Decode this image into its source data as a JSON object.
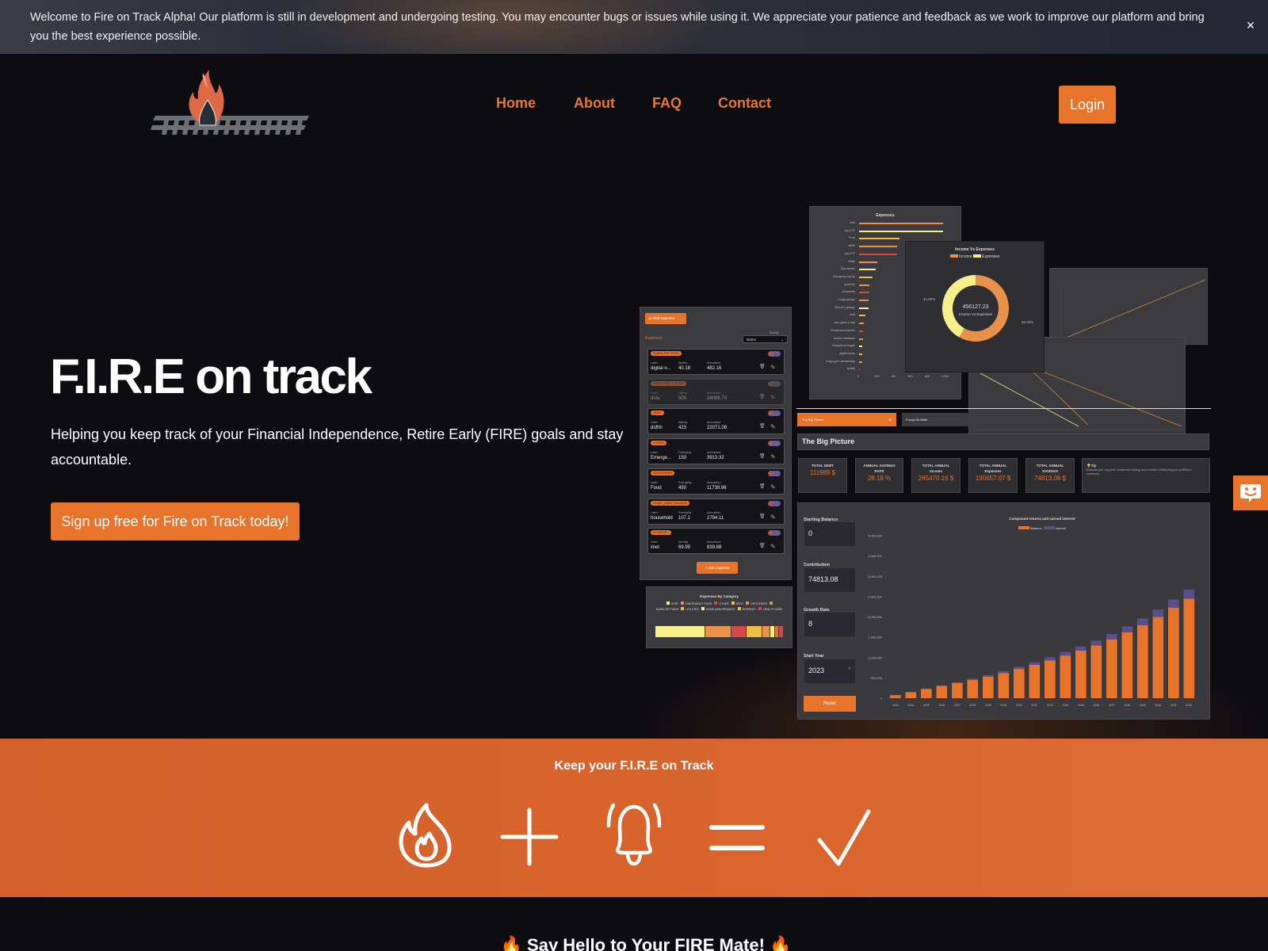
{
  "banner": {
    "text": "Welcome to Fire on Track Alpha! Our platform is still in development and undergoing testing. You may encounter bugs or issues while using it. We appreciate your patience and feedback as we work to improve our platform and bring you the best experience possible.",
    "close": "×"
  },
  "nav": {
    "items": [
      "Home",
      "About",
      "FAQ",
      "Contact"
    ],
    "login": "Login"
  },
  "hero": {
    "title": "F.I.R.E on track",
    "subtitle": "Helping you keep track of your Financial Independence, Retire Early (FIRE) goals and stay accountable.",
    "cta": "Sign up free for Fire on Track today!"
  },
  "colors": {
    "accent": "#e8742c",
    "background": "#0d0c11",
    "band": "#d9652d"
  },
  "mock": {
    "hide_expense": "Hide Expense",
    "expenses_label": "Expenses",
    "sort_label": "Sort By",
    "sort_value": "Name",
    "add_expense": "+ Add Expense",
    "field_label": "Label",
    "annualized_label": "Annualized",
    "rows": [
      {
        "category": "SUBSCRIPTIONS",
        "label": "digital o...",
        "freq": "Weekly",
        "amount": "40.18",
        "annual": "482.16",
        "disabled": false
      },
      {
        "category": "EMERGENCY_FUND",
        "label": "dsfa",
        "freq": "Weekly",
        "amount": "500",
        "annual": "26088.75",
        "disabled": true
      },
      {
        "category": "DEBT",
        "label": "dsfhh",
        "freq": "Weekly",
        "amount": "423",
        "annual": "22071.08",
        "disabled": false
      },
      {
        "category": "OTHER",
        "label": "Emerge...",
        "freq": "Fortnightly",
        "amount": "150",
        "annual": "3913.32",
        "disabled": false
      },
      {
        "category": "GROCERIES",
        "label": "Food",
        "freq": "Fortnightly",
        "amount": "450",
        "annual": "11739.96",
        "disabled": false
      },
      {
        "category": "HOME_MAINTENANCE",
        "label": "household",
        "freq": "Fortnightly",
        "amount": "107.1",
        "annual": "2794.11",
        "disabled": false
      },
      {
        "category": "INTERNET",
        "label": "iinet",
        "freq": "Monthly",
        "amount": "69.99",
        "annual": "839.88",
        "disabled": false
      }
    ],
    "category_chart": {
      "title": "Expenses By Category",
      "legend": [
        "DEBT",
        "EMERGENCY FUND",
        "OTHER",
        "RENT",
        "GROCERIES",
        "SUBSCRIPTIONS",
        "UTILITIES",
        "HOME MAINTENANCE",
        "INTERNET",
        "HEALTH CARE"
      ],
      "segments": [
        {
          "color": "#f6ef8a",
          "share": 40
        },
        {
          "color": "#e8914a",
          "share": 21
        },
        {
          "color": "#d9474a",
          "share": 12
        },
        {
          "color": "#eec04a",
          "share": 12
        },
        {
          "color": "#e8914a",
          "share": 6
        },
        {
          "color": "#f6ef8a",
          "share": 3
        },
        {
          "color": "#e8742c",
          "share": 3
        },
        {
          "color": "#d9474a",
          "share": 3
        }
      ]
    },
    "expenses_chart": {
      "title": "Expenses",
      "labels": [
        "dsfa",
        "ocp-ETF",
        "Food",
        "dsfhh",
        "ocp-ETF",
        "Smile",
        "Gym trainer",
        "Emergency top up",
        "quarterly",
        "household",
        "Tunga splurge",
        "Marion's splurge",
        "iinet",
        "who gives a crap",
        "Vodaphone marions",
        "marion medibank",
        "Vodaphone tungas",
        "digital ocean",
        "tunga gym membership",
        "spotify"
      ],
      "values": [
        1000,
        1000,
        480,
        450,
        450,
        220,
        200,
        160,
        120,
        120,
        110,
        110,
        80,
        60,
        50,
        50,
        40,
        40,
        40,
        10
      ],
      "colors": [
        "#e8914a",
        "#f6ef8a",
        "#eec04a",
        "#e8914a",
        "#d9474a",
        "#e8914a",
        "#f6ef8a",
        "#eec04a",
        "#e8914a",
        "#d9474a",
        "#e8914a",
        "#f6ef8a",
        "#eec04a",
        "#e8914a",
        "#d9474a",
        "#e8914a",
        "#f6ef8a",
        "#eec04a",
        "#e8914a",
        "#d9474a"
      ],
      "ticks": [
        "0",
        "200",
        "400",
        "600",
        "800",
        "1,000"
      ]
    },
    "donut": {
      "title": "Income Vs Expenses",
      "legend": [
        "Income",
        "Expenses"
      ],
      "center_value": "456127.23",
      "center_label": "Income Vs Expenses",
      "pct_income": "58.20%",
      "pct_expenses": "41.80%",
      "income_share": 58.2
    },
    "tabs": [
      "The Big Picture",
      "Focus On Debt"
    ],
    "big_picture_title": "The Big Picture",
    "stats": [
      {
        "label": "TOTAL DEBT",
        "value": "111989 $"
      },
      {
        "label": "ANNUAL SAVINGS RATE",
        "value": "28.18 %"
      },
      {
        "label": "TOTAL ANNUAL Income",
        "value": "265470.16 $"
      },
      {
        "label": "TOTAL ANNUAL Expenses",
        "value": "190657.07 $"
      },
      {
        "label": "TOTAL ANNUAL SAVINGS",
        "value": "74813.08 $"
      }
    ],
    "tip": {
      "title": "💡Tip",
      "text": "Evaluate your long-term investment strategy and consider rebalancing your portfolio if necessary."
    },
    "compound": {
      "starting_balance_label": "Starting Balance",
      "starting_balance": "0",
      "contribution_label": "Contribution",
      "contribution": "74813.08",
      "growth_label": "Growth Rate",
      "growth": "8",
      "start_year_label": "Start Year",
      "start_year": "2023",
      "reset": "Reset"
    }
  },
  "chart_data": {
    "type": "bar",
    "title": "Compound returns and earned interest",
    "categories": [
      "2023",
      "2024",
      "2025",
      "2026",
      "2027",
      "2028",
      "2029",
      "2030",
      "2031",
      "2032",
      "2033",
      "2034",
      "2035",
      "2036",
      "2037",
      "2038",
      "2039",
      "2040",
      "2041",
      "2042"
    ],
    "series": [
      {
        "name": "Balance",
        "color": "#e8742c",
        "values": [
          74813,
          150000,
          225000,
          300000,
          370000,
          450000,
          530000,
          620000,
          720000,
          820000,
          930000,
          1050000,
          1170000,
          1300000,
          1450000,
          1620000,
          1800000,
          2000000,
          2230000,
          2450000
        ]
      },
      {
        "name": "Interest",
        "color": "#5a4f8a",
        "values": [
          0,
          6000,
          12000,
          18000,
          25000,
          32000,
          40000,
          48000,
          57000,
          67000,
          78000,
          90000,
          103000,
          117000,
          132000,
          148000,
          165000,
          183000,
          202000,
          222000
        ]
      }
    ],
    "stacked": true,
    "ylim": [
      0,
      4000000
    ],
    "yticks": [
      "0",
      "500,000",
      "1,000,000",
      "1,500,000",
      "2,000,000",
      "2,500,000",
      "3,000,000",
      "3,500,000",
      "4,000,000"
    ]
  },
  "band": {
    "title": "Keep your F.I.R.E on Track",
    "icons": [
      "fire-icon",
      "plus-icon",
      "bell-icon",
      "equals-icon",
      "check-icon"
    ]
  },
  "hello": {
    "title": "🔥 Say Hello to Your FIRE Mate! 🔥"
  }
}
